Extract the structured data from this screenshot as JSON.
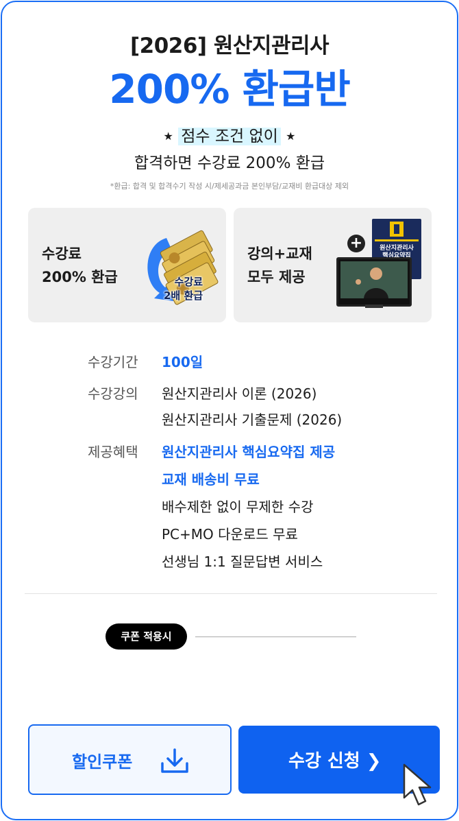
{
  "header": {
    "title_line1": "[2026] 원산지관리사",
    "title_line2": "200% 환급반"
  },
  "condition": {
    "star_left": "★",
    "highlight": "점수 조건 없이",
    "star_right": "★",
    "line2": "합격하면 수강료 200% 환급",
    "note": "*환급: 합격 및 합격수기 작성 시/제세공과금 본인부담/교재비 환급대상 제외"
  },
  "cards": [
    {
      "line1": "수강료",
      "line2": "200% 환급",
      "badge_line1": "수강료",
      "badge_line2": "2배 환급"
    },
    {
      "line1": "강의+교재",
      "line2": "모두 제공",
      "plus": "+",
      "book_line1": "원산지관리사",
      "book_line2": "핵심요약집"
    }
  ],
  "details": {
    "period_label": "수강기간",
    "period_value": "100일",
    "lectures_label": "수강강의",
    "lectures": [
      "원산지관리사 이론 (2026)",
      "원산지관리사 기출문제 (2026)"
    ],
    "benefits_label": "제공혜택",
    "benefits_highlight": [
      "원산지관리사 핵심요약집 제공",
      "교재 배송비 무료"
    ],
    "benefits": [
      "배수제한 없이 무제한 수강",
      "PC+MO 다운로드 무료",
      "선생님 1:1 질문답변 서비스"
    ]
  },
  "coupon": {
    "pill": "쿠폰 적용시"
  },
  "buttons": {
    "coupon_label": "할인쿠폰",
    "apply_label": "수강 신청 ❯"
  },
  "colors": {
    "accent": "#1769f0",
    "button": "#0f62f0",
    "border": "#1a6ef5"
  }
}
